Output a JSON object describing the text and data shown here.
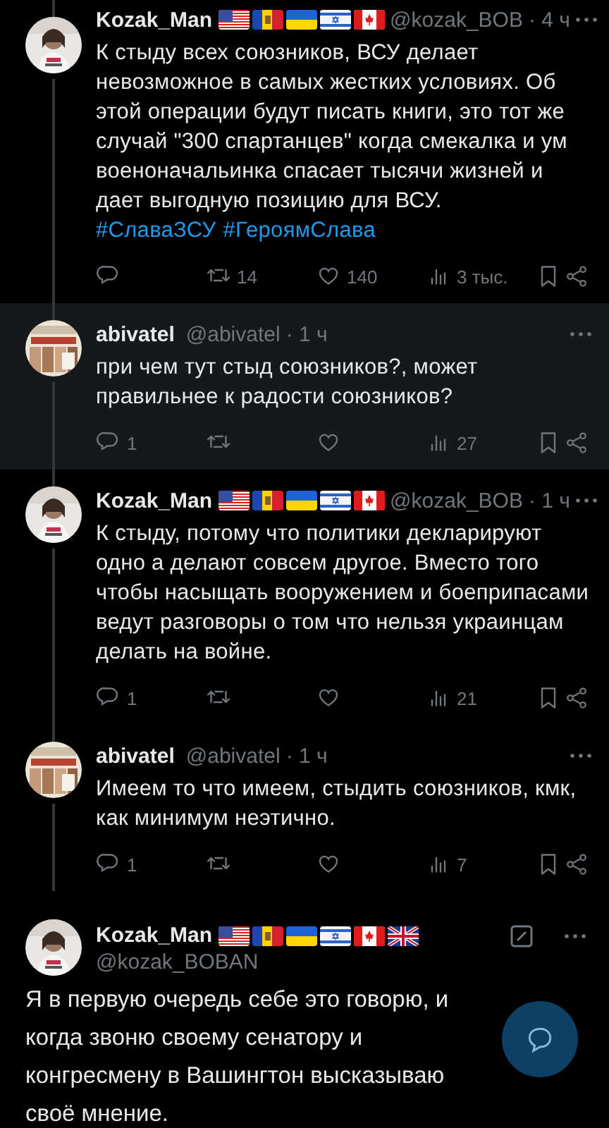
{
  "tweets": [
    {
      "kind": "reply",
      "highlighted": false,
      "author": "Kozak_Man",
      "flags": [
        {
          "kind": "us"
        },
        {
          "kind": "md"
        },
        {
          "kind": "ua"
        },
        {
          "kind": "il"
        },
        {
          "kind": "ca"
        }
      ],
      "handle": "@kozak_BOB",
      "time": "· 4 ч",
      "avatar": {
        "kind": "picture"
      },
      "text": "К стыду всех союзников, ВСУ делает невозможное в самых жестких условиях. Об этой операции будут писать книги, это тот же случай \"300 спартанцев\" когда смекалка и ум военоначальинка спасает тысячи жизней и дает выгодную позицию для ВСУ.",
      "hashtags": [
        "#СлаваЗСУ",
        "#ГероямСлава"
      ],
      "actions": [
        {
          "kind": "reply"
        },
        {
          "kind": "retweet",
          "count": "14"
        },
        {
          "kind": "like",
          "count": "140"
        },
        {
          "kind": "views",
          "count": "3 тыс."
        },
        {
          "kind": "bookmark"
        },
        {
          "kind": "share"
        }
      ]
    },
    {
      "kind": "reply",
      "highlighted": true,
      "author": "abivatel",
      "handle": "@abivatel",
      "time": "· 1 ч",
      "avatar": {
        "kind": "picture"
      },
      "text": "при чем тут стыд союзников?, может правильнее к радости союзников?",
      "actions": [
        {
          "kind": "reply",
          "count": "1"
        },
        {
          "kind": "retweet"
        },
        {
          "kind": "like"
        },
        {
          "kind": "views",
          "count": "27"
        },
        {
          "kind": "bookmark"
        },
        {
          "kind": "share"
        }
      ]
    },
    {
      "kind": "reply",
      "highlighted": false,
      "author": "Kozak_Man",
      "flags": [
        {
          "kind": "us"
        },
        {
          "kind": "md"
        },
        {
          "kind": "ua"
        },
        {
          "kind": "il"
        },
        {
          "kind": "ca"
        }
      ],
      "handle": "@kozak_BOB",
      "time": "· 1 ч",
      "avatar": {
        "kind": "picture"
      },
      "text": "К стыду, потому что политики декларируют одно а делают совсем другое. Вместо того чтобы насыщать вооружением и боеприпасами ведут разговоры о том что нельзя украинцам делать на войне.",
      "actions": [
        {
          "kind": "reply",
          "count": "1"
        },
        {
          "kind": "retweet"
        },
        {
          "kind": "like"
        },
        {
          "kind": "views",
          "count": "21"
        },
        {
          "kind": "bookmark"
        },
        {
          "kind": "share"
        }
      ]
    },
    {
      "kind": "reply",
      "highlighted": false,
      "author": "abivatel",
      "handle": "@abivatel",
      "time": "· 1 ч",
      "avatar": {
        "kind": "picture"
      },
      "text": "Имеем то что имеем, стыдить союзников, кмк, как минимум неэтично.",
      "actions": [
        {
          "kind": "reply",
          "count": "1"
        },
        {
          "kind": "retweet"
        },
        {
          "kind": "like"
        },
        {
          "kind": "views",
          "count": "7"
        },
        {
          "kind": "bookmark"
        },
        {
          "kind": "share"
        }
      ]
    },
    {
      "kind": "focus",
      "highlighted": false,
      "author": "Kozak_Man",
      "flags": [
        {
          "kind": "us"
        },
        {
          "kind": "md"
        },
        {
          "kind": "ua"
        },
        {
          "kind": "il"
        },
        {
          "kind": "ca"
        },
        {
          "kind": "gb"
        }
      ],
      "handle": "@kozak_BOBAN",
      "avatar": {
        "kind": "picture"
      },
      "text": "Я в первую очередь себе это говорю, и когда звоню своему сенатору и конгресмену в Вашингтон высказываю своё мнение."
    }
  ]
}
